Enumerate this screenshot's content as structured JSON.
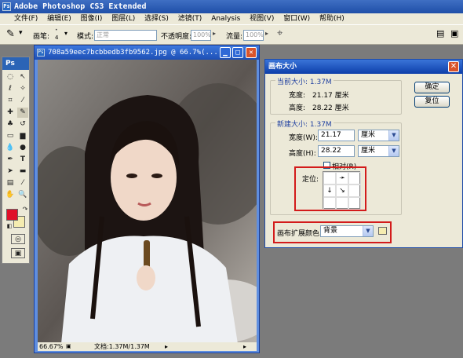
{
  "app": {
    "title": "Adobe Photoshop CS3 Extended"
  },
  "menu": [
    "文件(F)",
    "编辑(E)",
    "图像(I)",
    "图层(L)",
    "选择(S)",
    "滤镜(T)",
    "Analysis",
    "视图(V)",
    "窗口(W)",
    "帮助(H)"
  ],
  "options": {
    "brush_label": "画笔:",
    "brush_size": "4",
    "mode_label": "模式:",
    "mode_value": "正常",
    "opacity_label": "不透明度:",
    "opacity_value": "100%",
    "flow_label": "流量:",
    "flow_value": "100%"
  },
  "toolbox": {
    "header": "Ps",
    "foreground_color": "#e0102a",
    "background_color": "#f5ecb0"
  },
  "document": {
    "title": "708a59eec7bcbbedb3fb9562.jpg @ 66.7%(...",
    "zoom": "66.67%",
    "doc_info": "文档:1.37M/1.37M"
  },
  "dialog": {
    "title": "画布大小",
    "current_size_label": "当前大小: 1.37M",
    "current_width_label": "宽度:",
    "current_width_value": "21.17 厘米",
    "current_height_label": "高度:",
    "current_height_value": "28.22 厘米",
    "new_size_label": "新建大小: 1.37M",
    "width_label": "宽度(W):",
    "width_value": "21.17",
    "width_unit": "厘米",
    "height_label": "高度(H):",
    "height_value": "28.22",
    "height_unit": "厘米",
    "relative_label": "相对(R)",
    "anchor_label": "定位:",
    "extension_color_label": "画布扩展颜色:",
    "extension_color_value": "背景",
    "ok_button": "确定",
    "reset_button": "复位"
  }
}
